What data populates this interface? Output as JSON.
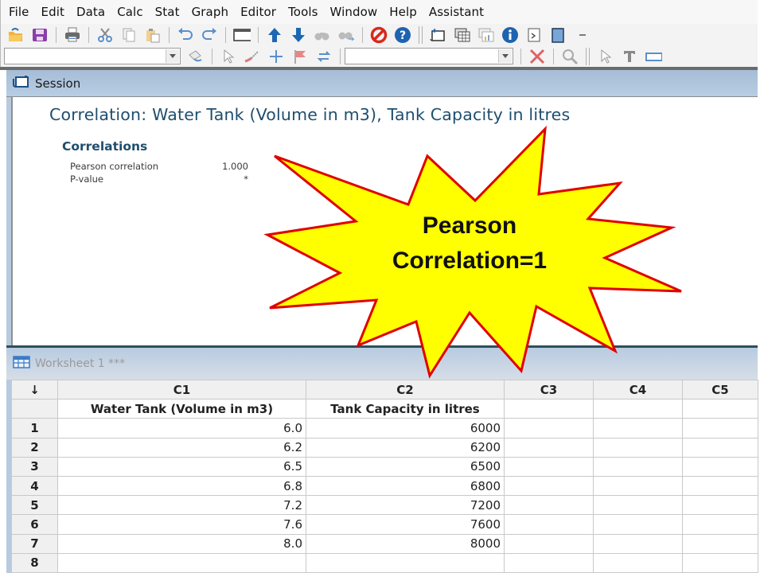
{
  "menu": [
    "File",
    "Edit",
    "Data",
    "Calc",
    "Stat",
    "Graph",
    "Editor",
    "Tools",
    "Window",
    "Help",
    "Assistant"
  ],
  "toolbar1": {
    "icons": [
      "open-icon",
      "save-icon",
      "print-icon",
      "cut-icon",
      "copy-icon",
      "paste-icon",
      "undo-icon",
      "redo-icon",
      "window-icon",
      "up-arrow-icon",
      "down-arrow-icon",
      "find-icon",
      "find-replace-icon",
      "cancel-icon",
      "help-icon",
      "session-icon",
      "worksheet-icon",
      "graph-folder-icon",
      "info-icon",
      "command-icon",
      "notebook-icon"
    ]
  },
  "toolbar2": {
    "combo1_value": "",
    "combo2_value": "",
    "icons": [
      "brush-icon",
      "select-icon",
      "brush-line-icon",
      "crosshair-icon",
      "flag-icon",
      "swap-icon",
      "delete-icon",
      "zoom-icon",
      "pointer-icon",
      "text-icon",
      "rectangle-icon"
    ]
  },
  "session": {
    "title": "Session",
    "output_title": "Correlation: Water Tank (Volume in m3), Tank Capacity in litres",
    "section": "Correlations",
    "rows": [
      {
        "label": "Pearson correlation",
        "value": "1.000"
      },
      {
        "label": "P-value",
        "value": "*"
      }
    ]
  },
  "callout": {
    "line1": "Pearson",
    "line2": "Correlation=1",
    "fill": "#ffff00",
    "stroke": "#e00000"
  },
  "worksheet": {
    "title": "Worksheet 1 ***",
    "corner": "↓",
    "columns": [
      "C1",
      "C2",
      "C3",
      "C4",
      "C5"
    ],
    "names": [
      "Water Tank (Volume in m3)",
      "Tank Capacity in litres",
      "",
      "",
      ""
    ],
    "rows": [
      {
        "n": "1",
        "c1": "6.0",
        "c2": "6000"
      },
      {
        "n": "2",
        "c1": "6.2",
        "c2": "6200"
      },
      {
        "n": "3",
        "c1": "6.5",
        "c2": "6500"
      },
      {
        "n": "4",
        "c1": "6.8",
        "c2": "6800"
      },
      {
        "n": "5",
        "c1": "7.2",
        "c2": "7200"
      },
      {
        "n": "6",
        "c1": "7.6",
        "c2": "7600"
      },
      {
        "n": "7",
        "c1": "8.0",
        "c2": "8000"
      },
      {
        "n": "8",
        "c1": "",
        "c2": ""
      }
    ]
  }
}
